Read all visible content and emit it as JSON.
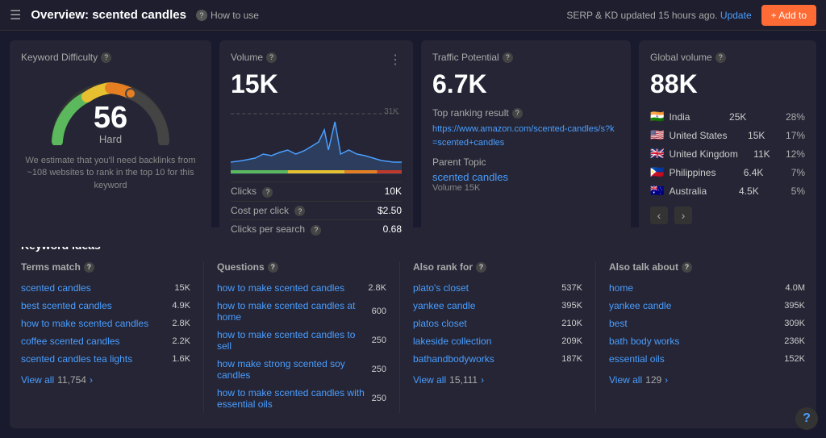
{
  "topbar": {
    "title": "Overview: scented candles",
    "help_label": "How to use",
    "status": "SERP & KD updated 15 hours ago.",
    "update_label": "Update",
    "add_label": "+ Add to"
  },
  "kd_card": {
    "label": "Keyword Difficulty",
    "value": "56",
    "level": "Hard",
    "description": "We estimate that you'll need backlinks from ~108 websites to rank in the top 10 for this keyword"
  },
  "volume_card": {
    "label": "Volume",
    "value": "15K",
    "max_label": "31K",
    "clicks_label": "Clicks",
    "clicks_value": "10K",
    "cpc_label": "Cost per click",
    "cpc_value": "$2.50",
    "cps_label": "Clicks per search",
    "cps_value": "0.68"
  },
  "traffic_card": {
    "label": "Traffic Potential",
    "value": "6.7K",
    "top_ranking_label": "Top ranking result",
    "top_ranking_url": "https://www.amazon.com/scented-candles/s?k=scented+candles",
    "parent_topic_label": "Parent Topic",
    "parent_topic_link": "scented candles",
    "volume_label": "Volume 15K"
  },
  "global_card": {
    "label": "Global volume",
    "value": "88K",
    "countries": [
      {
        "flag": "🇮🇳",
        "name": "India",
        "vol": "25K",
        "pct": "28%"
      },
      {
        "flag": "🇺🇸",
        "name": "United States",
        "vol": "15K",
        "pct": "17%"
      },
      {
        "flag": "🇬🇧",
        "name": "United Kingdom",
        "vol": "11K",
        "pct": "12%"
      },
      {
        "flag": "🇵🇭",
        "name": "Philippines",
        "vol": "6.4K",
        "pct": "7%"
      },
      {
        "flag": "🇦🇺",
        "name": "Australia",
        "vol": "4.5K",
        "pct": "5%"
      }
    ]
  },
  "kw_ideas": {
    "title": "Keyword ideas",
    "terms_match": {
      "label": "Terms match",
      "items": [
        {
          "text": "scented candles",
          "vol": "15K"
        },
        {
          "text": "best scented candles",
          "vol": "4.9K"
        },
        {
          "text": "how to make scented candles",
          "vol": "2.8K"
        },
        {
          "text": "coffee scented candles",
          "vol": "2.2K"
        },
        {
          "text": "scented candles tea lights",
          "vol": "1.6K"
        }
      ],
      "view_all": "View all",
      "view_all_count": "11,754",
      "view_all_chevron": "›"
    },
    "questions": {
      "label": "Questions",
      "items": [
        {
          "text": "how to make scented candles",
          "vol": "2.8K"
        },
        {
          "text": "how to make scented candles at home",
          "vol": "600"
        },
        {
          "text": "how to make scented candles to sell",
          "vol": "250"
        },
        {
          "text": "how make strong scented soy candles",
          "vol": "250"
        },
        {
          "text": "how to make scented candles with essential oils",
          "vol": "250"
        }
      ]
    },
    "also_rank": {
      "label": "Also rank for",
      "items": [
        {
          "text": "plato's closet",
          "vol": "537K"
        },
        {
          "text": "yankee candle",
          "vol": "395K"
        },
        {
          "text": "platos closet",
          "vol": "210K"
        },
        {
          "text": "lakeside collection",
          "vol": "209K"
        },
        {
          "text": "bathandbodyworks",
          "vol": "187K"
        }
      ],
      "view_all": "View all",
      "view_all_count": "15,111",
      "view_all_chevron": "›"
    },
    "also_talk": {
      "label": "Also talk about",
      "items": [
        {
          "text": "home",
          "vol": "4.0M"
        },
        {
          "text": "yankee candle",
          "vol": "395K"
        },
        {
          "text": "best",
          "vol": "309K"
        },
        {
          "text": "bath body works",
          "vol": "236K"
        },
        {
          "text": "essential oils",
          "vol": "152K"
        }
      ],
      "view_all": "View all",
      "view_all_count": "129",
      "view_all_chevron": "›"
    }
  }
}
